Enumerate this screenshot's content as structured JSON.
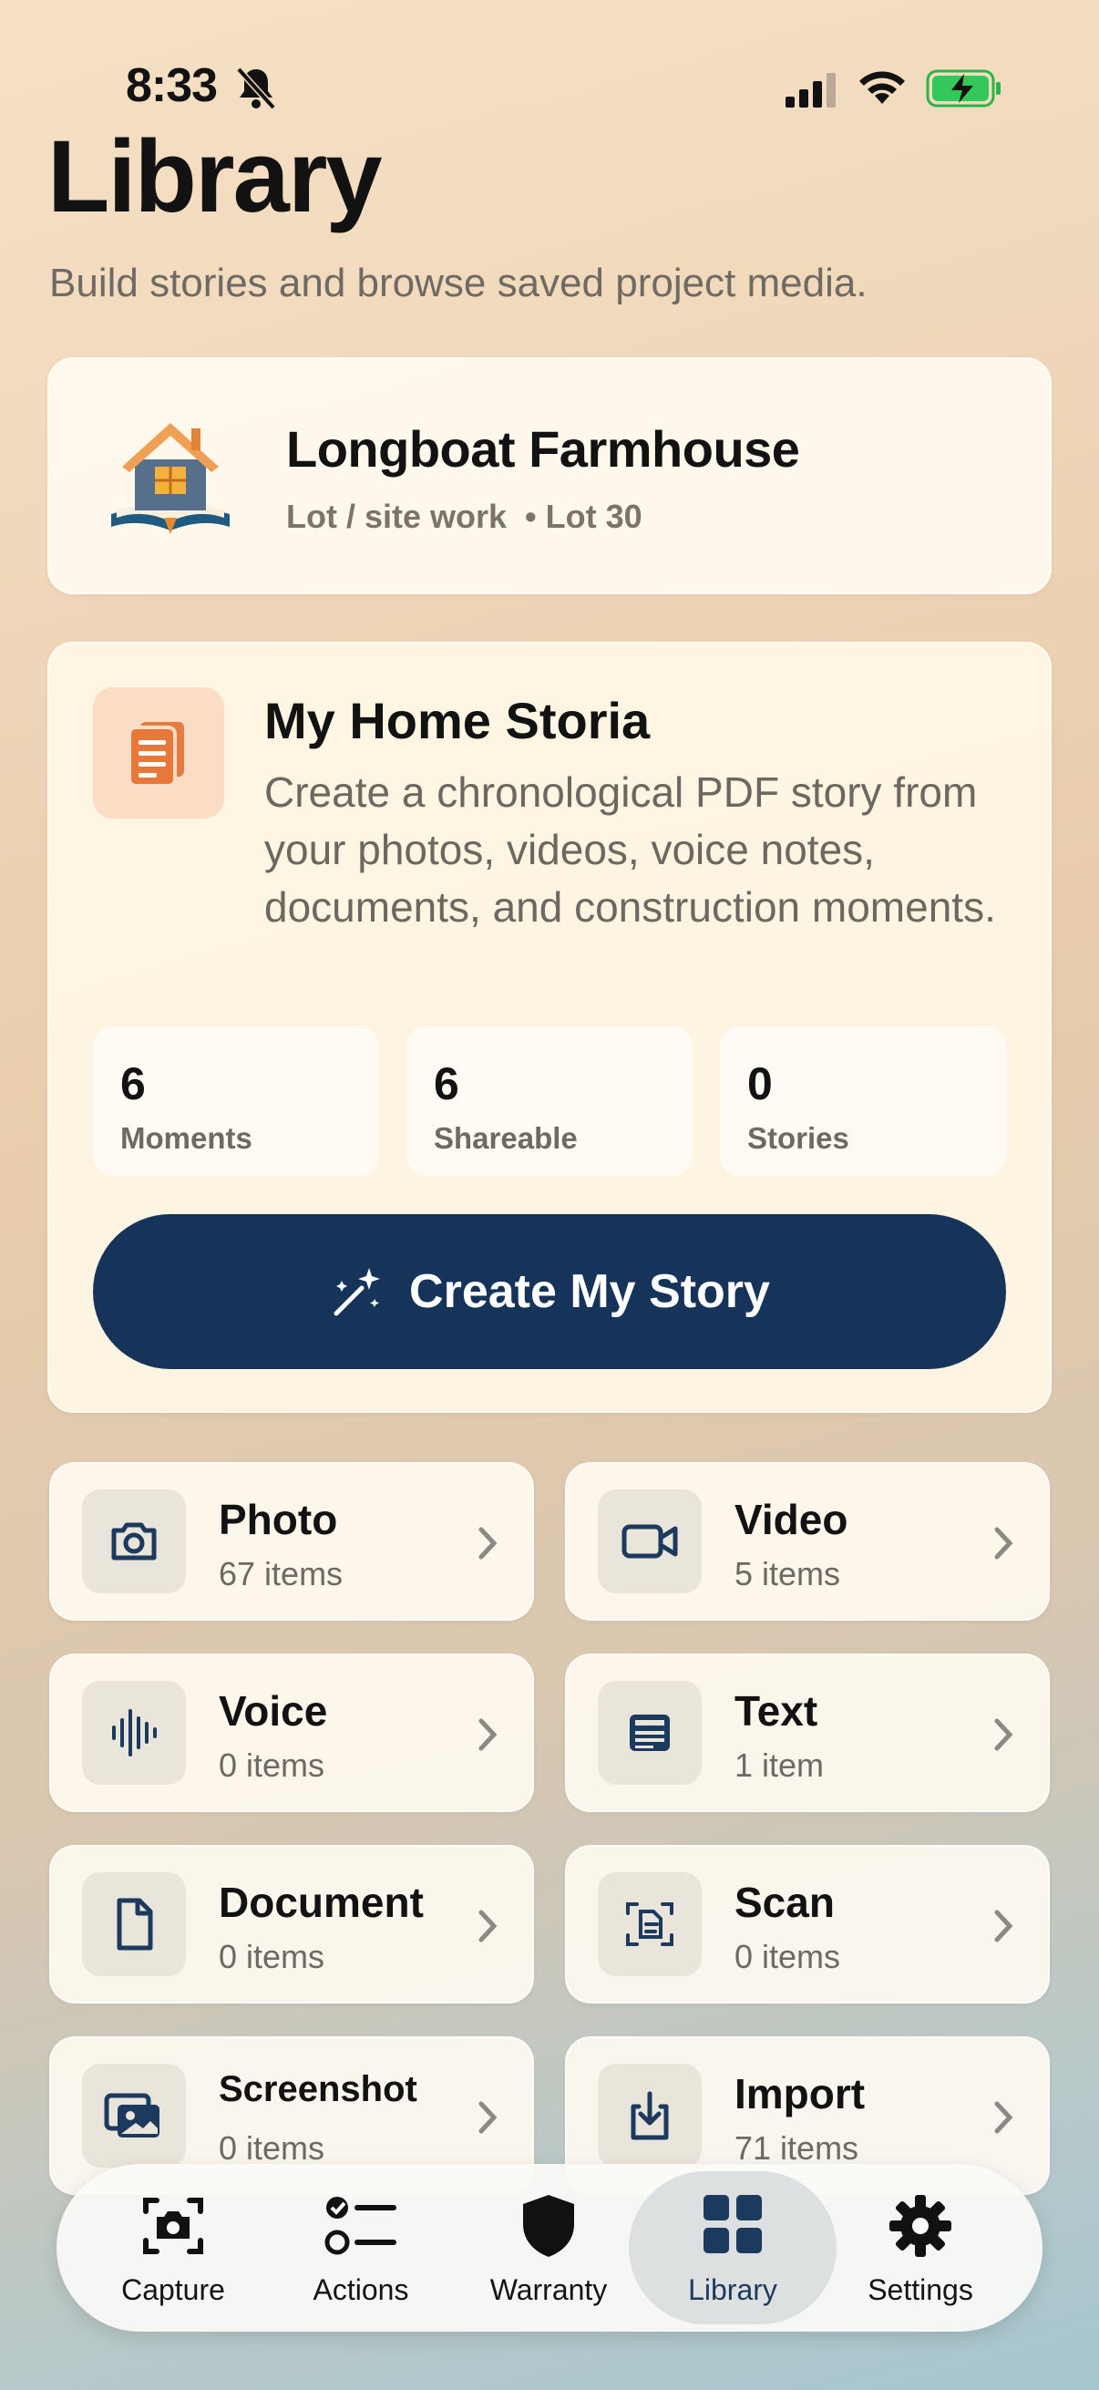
{
  "status_bar": {
    "time": "8:33"
  },
  "header": {
    "title": "Library",
    "subtitle": "Build stories and browse saved project media."
  },
  "project": {
    "name": "Longboat Farmhouse",
    "meta": "Lot / site work  • Lot 30"
  },
  "storia": {
    "title": "My Home Storia",
    "description": "Create a chronological PDF story from your photos, videos, voice notes, documents, and construction moments.",
    "stats": [
      {
        "value": "6",
        "label": "Moments"
      },
      {
        "value": "6",
        "label": "Shareable"
      },
      {
        "value": "0",
        "label": "Stories"
      }
    ],
    "cta_label": "Create My Story"
  },
  "media": [
    {
      "name": "Photo",
      "count": "67 items",
      "icon": "camera-icon"
    },
    {
      "name": "Video",
      "count": "5 items",
      "icon": "video-icon"
    },
    {
      "name": "Voice",
      "count": "0 items",
      "icon": "waveform-icon"
    },
    {
      "name": "Text",
      "count": "1 item",
      "icon": "text-note-icon"
    },
    {
      "name": "Document",
      "count": "0 items",
      "icon": "document-icon"
    },
    {
      "name": "Scan",
      "count": "0 items",
      "icon": "scan-icon"
    },
    {
      "name": "Screenshot",
      "count": "0 items",
      "icon": "screenshot-icon"
    },
    {
      "name": "Import",
      "count": "71 items",
      "icon": "import-icon"
    }
  ],
  "tabs": [
    {
      "label": "Capture",
      "icon": "camera-viewfinder-icon"
    },
    {
      "label": "Actions",
      "icon": "checklist-icon"
    },
    {
      "label": "Warranty",
      "icon": "shield-icon"
    },
    {
      "label": "Library",
      "icon": "grid-icon",
      "active": true
    },
    {
      "label": "Settings",
      "icon": "gear-icon"
    }
  ],
  "colors": {
    "accent": "#16345a",
    "storia_icon": "#e8773a",
    "icon_navy": "#1c3a5e"
  }
}
